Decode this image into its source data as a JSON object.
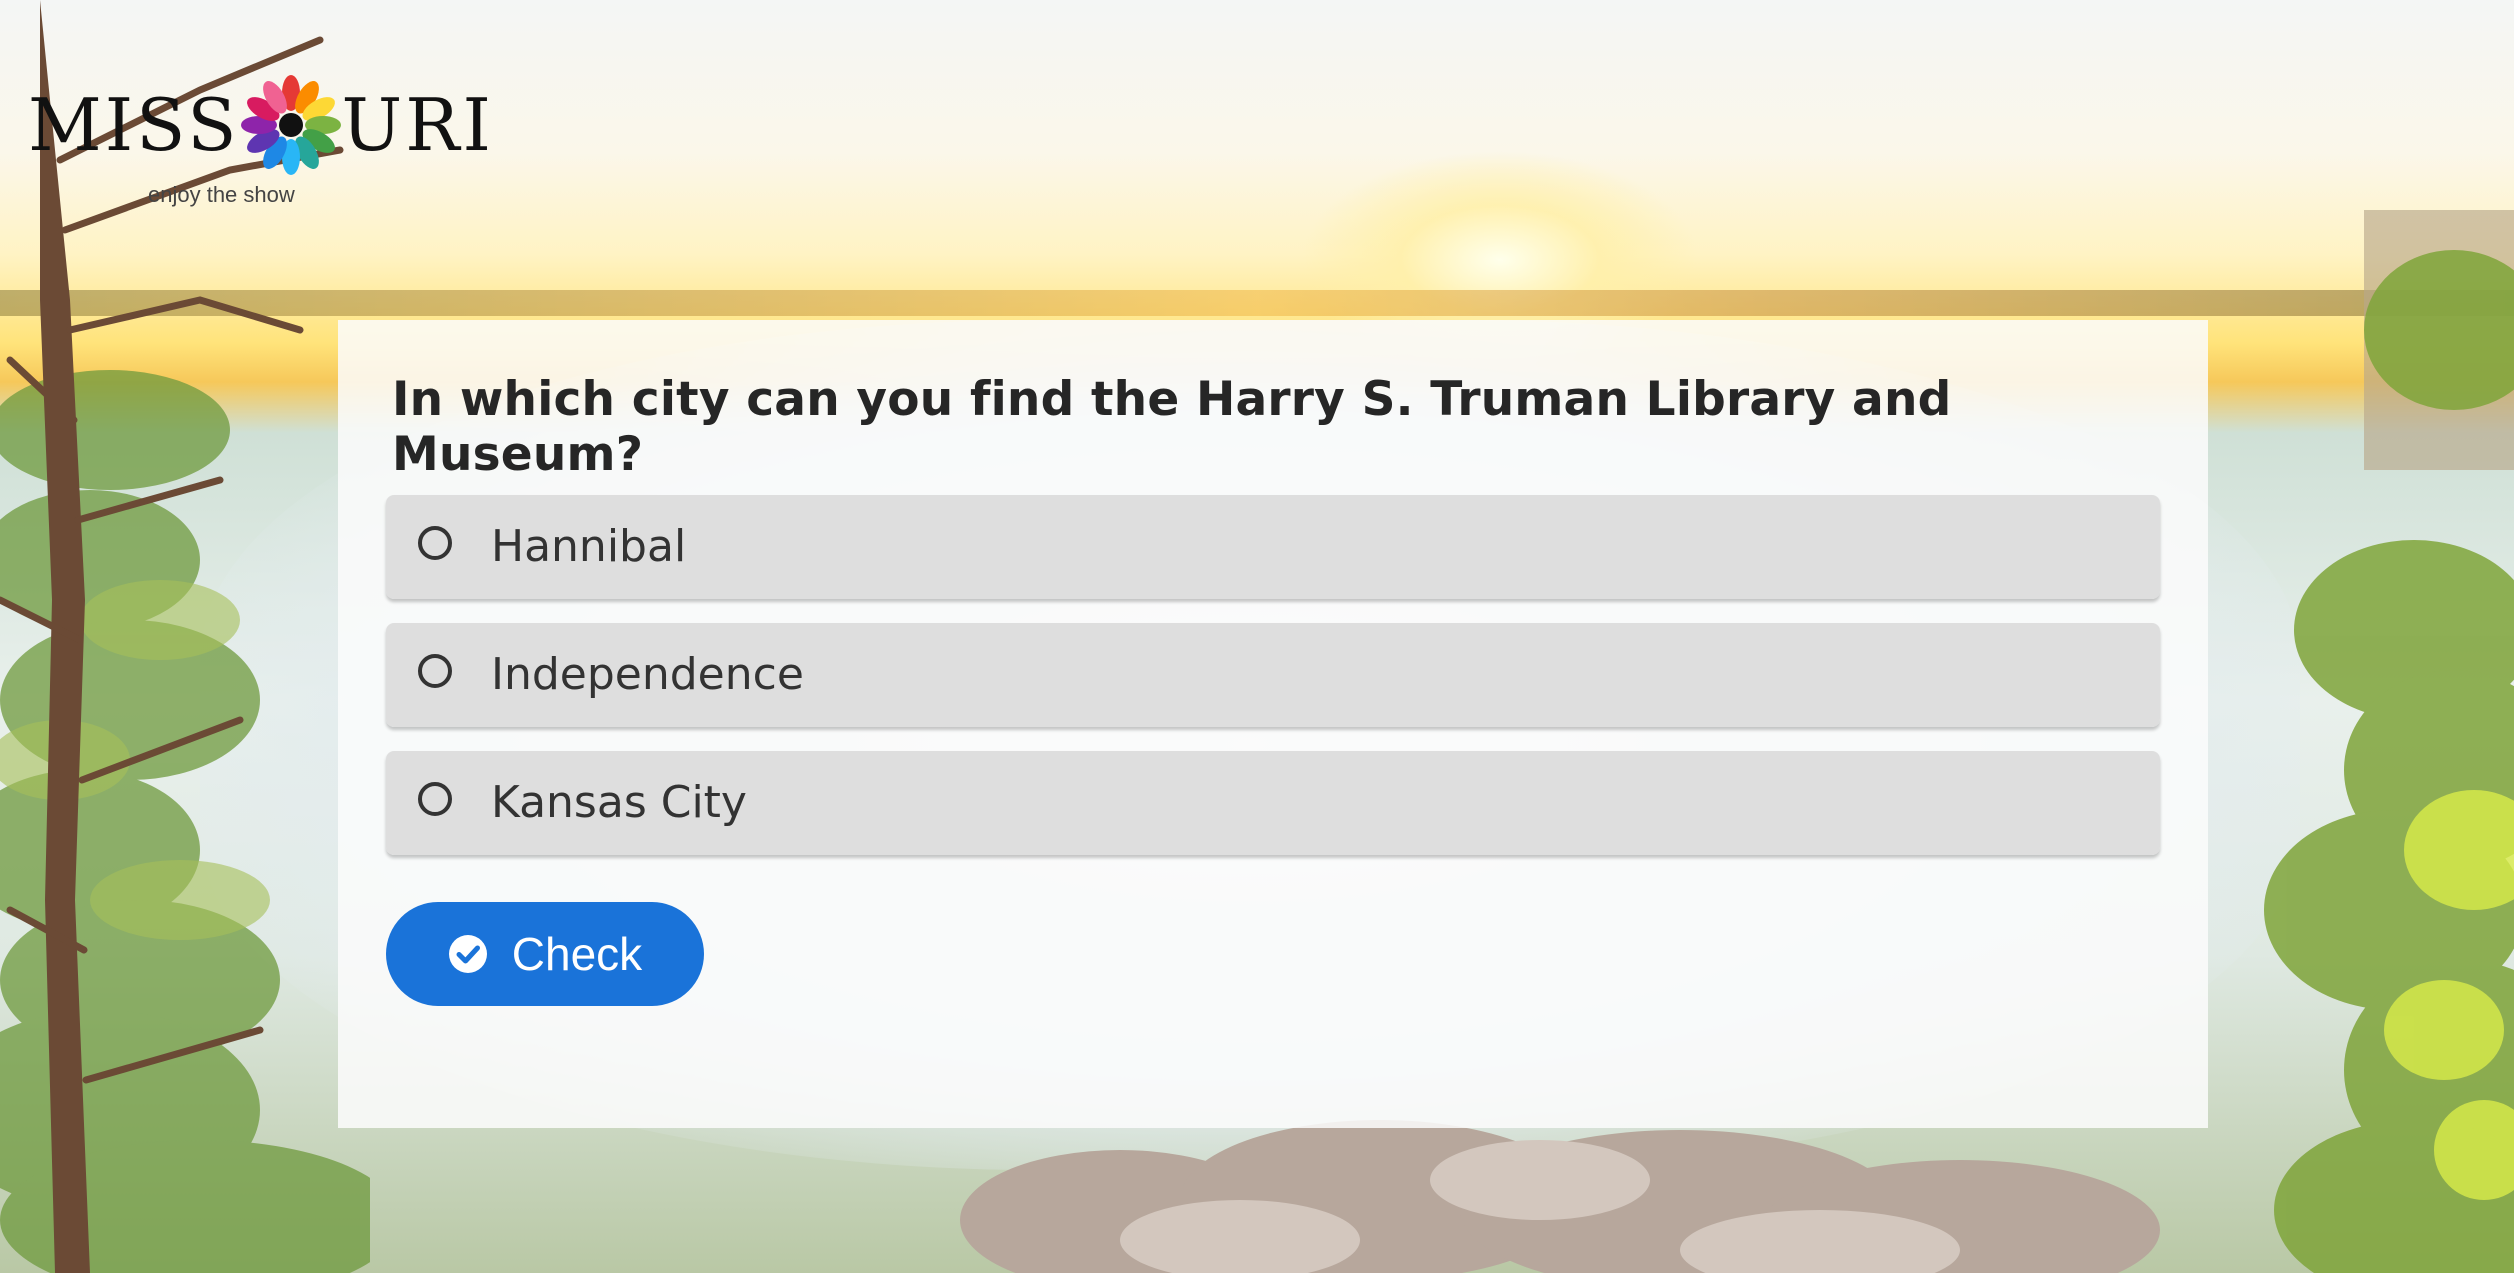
{
  "brand": {
    "name_left": "MISS",
    "name_right": "URI",
    "tagline": "enjoy the show"
  },
  "quiz": {
    "question": "In which city can you find the Harry S. Truman Library and Museum?",
    "options": [
      {
        "label": "Hannibal",
        "selected": false
      },
      {
        "label": "Independence",
        "selected": false
      },
      {
        "label": "Kansas City",
        "selected": false
      }
    ],
    "check_label": "Check"
  },
  "colors": {
    "button": "#1a73d9",
    "option_bg": "#dcdcdc",
    "question_text": "#262626"
  }
}
